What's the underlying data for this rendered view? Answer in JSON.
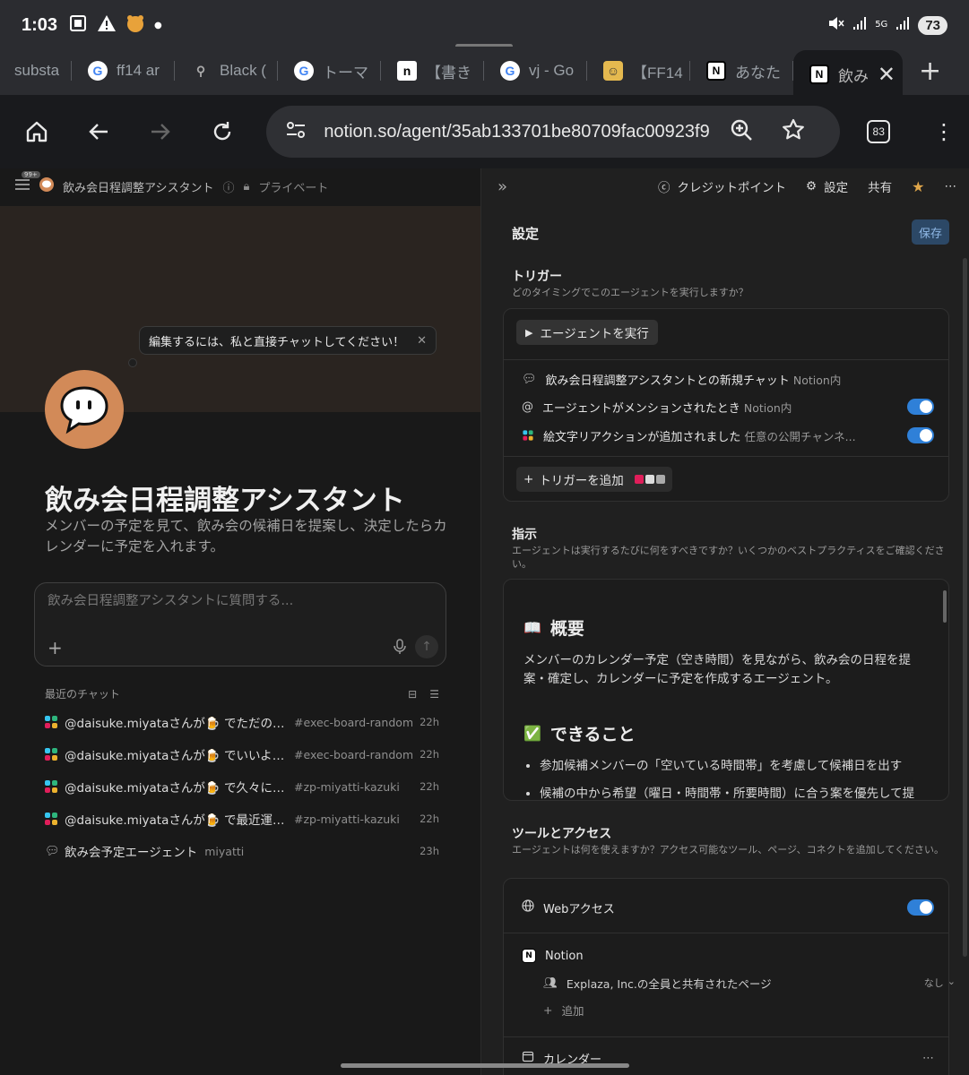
{
  "status": {
    "time": "1:03",
    "network": "5G",
    "battery": "73"
  },
  "tabs": [
    {
      "label": "substa",
      "icon": "none"
    },
    {
      "label": "ff14 ar",
      "icon": "google"
    },
    {
      "label": "Black (",
      "icon": "feather"
    },
    {
      "label": "トーマ",
      "icon": "google"
    },
    {
      "label": "【書き",
      "icon": "n-logo"
    },
    {
      "label": "vj - Go",
      "icon": "google"
    },
    {
      "label": "【FF14",
      "icon": "bot"
    },
    {
      "label": "あなた",
      "icon": "notion"
    },
    {
      "label": "飲み",
      "icon": "notion",
      "active": true
    }
  ],
  "address": {
    "url": "notion.so/agent/35ab133701be80709fac00923f9",
    "tab_count": "83"
  },
  "left": {
    "breadcrumb_badge": "99+",
    "breadcrumb_title": "飲み会日程調整アシスタント",
    "breadcrumb_private": "プライベート",
    "tooltip": "編集するには、私と直接チャットしてください！",
    "title": "飲み会日程調整アシスタント",
    "description": "メンバーの予定を見て、飲み会の候補日を提案し、決定したらカレンダーに予定を入れます。",
    "chat_placeholder": "飲み会日程調整アシスタントに質問する...",
    "recent_header": "最近のチャット",
    "recent": [
      {
        "title": "@daisuke.miyataさんが🍺 でただのお…",
        "channel": "#exec-board-random",
        "time": "22h",
        "icon": "slack"
      },
      {
        "title": "@daisuke.miyataさんが🍺 でいいよ！…",
        "channel": "#exec-board-random",
        "time": "22h",
        "icon": "slack"
      },
      {
        "title": "@daisuke.miyataさんが🍺 で久々に入る…",
        "channel": "#zp-miyatti-kazuki",
        "time": "22h",
        "icon": "slack"
      },
      {
        "title": "@daisuke.miyataさんが🍺 で最近運営し…",
        "channel": "#zp-miyatti-kazuki",
        "time": "22h",
        "icon": "slack"
      },
      {
        "title": "飲み会予定エージェント",
        "channel": "miyatti",
        "time": "23h",
        "icon": "chat"
      }
    ]
  },
  "right": {
    "top": {
      "credits": "クレジットポイント",
      "settings": "設定",
      "share": "共有"
    },
    "settings_title": "設定",
    "save": "保存",
    "trigger": {
      "title": "トリガー",
      "subtitle": "どのタイミングでこのエージェントを実行しますか？",
      "run_label": "エージェントを実行",
      "rows": [
        {
          "text": "飲み会日程調整アシスタントとの新規チャット",
          "sub": "Notion内",
          "icon": "chat",
          "toggle": false
        },
        {
          "text": "エージェントがメンションされたとき",
          "sub": "Notion内",
          "icon": "at",
          "toggle": true
        },
        {
          "text": "絵文字リアクションが追加されました",
          "sub": "任意の公開チャンネ...",
          "icon": "slack",
          "toggle": true
        }
      ],
      "add_label": "トリガーを追加"
    },
    "instructions": {
      "title": "指示",
      "subtitle": "エージェントは実行するたびに何をすべきですか？いくつかのベストプラクティスをご確認ください。",
      "overview_heading": "概要",
      "overview_emoji": "📖",
      "overview_text": "メンバーのカレンダー予定（空き時間）を見ながら、飲み会の日程を提案・確定し、カレンダーに予定を作成するエージェント。",
      "can_heading": "できること",
      "can_emoji": "✅",
      "can_items": [
        "参加候補メンバーの「空いている時間帯」を考慮して候補日を出す",
        "候補の中から希望（曜日・時間帯・所要時間）に合う案を優先して提"
      ]
    },
    "tools": {
      "title": "ツールとアクセス",
      "subtitle": "エージェントは何を使えますか？アクセス可能なツール、ページ、コネクトを追加してください。",
      "web": "Webアクセス",
      "notion": "Notion",
      "shared_pages": "Explaza, Inc.の全員と共有されたページ",
      "none_label": "なし",
      "add": "追加",
      "calendar": "カレンダー"
    }
  }
}
